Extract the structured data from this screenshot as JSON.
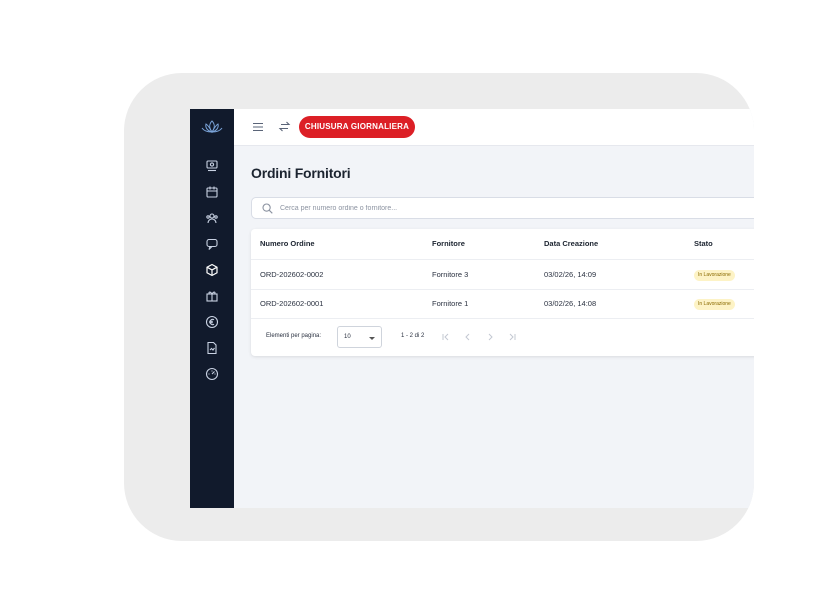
{
  "topbar": {
    "chiusura_button": "CHIUSURA GIORNALIERA"
  },
  "page": {
    "title": "Ordini Fornitori"
  },
  "search": {
    "placeholder": "Cerca per numero ordine o fornitore..."
  },
  "table": {
    "columns": [
      "Numero Ordine",
      "Fornitore",
      "Data Creazione",
      "Stato"
    ],
    "rows": [
      {
        "numero": "ORD-202602-0002",
        "fornitore": "Fornitore 3",
        "data": "03/02/26, 14:09",
        "stato": "In Lavorazione"
      },
      {
        "numero": "ORD-202602-0001",
        "fornitore": "Fornitore 1",
        "data": "03/02/26, 14:08",
        "stato": "In Lavorazione"
      }
    ]
  },
  "pagination": {
    "label": "Elementi per pagina:",
    "page_size": "10",
    "range": "1 - 2 di 2"
  },
  "sidebar": {
    "icons": [
      "lotus-logo-icon",
      "cash-register-icon",
      "calendar-icon",
      "users-icon",
      "chat-icon",
      "box-icon",
      "gift-icon",
      "euro-icon",
      "document-icon",
      "dashboard-icon"
    ]
  },
  "colors": {
    "sidebar": "#111a2c",
    "accent": "#dc1f26",
    "badge_bg": "#fdf3c6",
    "background": "#f2f4f8"
  }
}
